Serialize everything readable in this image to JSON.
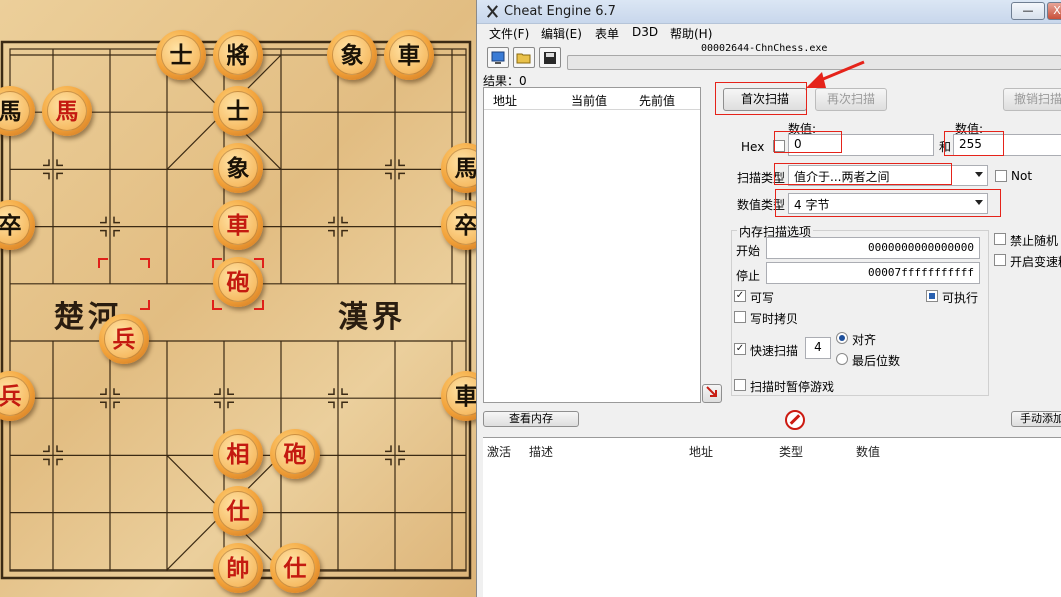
{
  "board": {
    "river_left": "楚河",
    "river_right": "漢界"
  },
  "pieces": [
    {
      "id": "black-shi-1",
      "label": "士",
      "side": "black"
    },
    {
      "id": "black-jiang",
      "label": "將",
      "side": "black"
    },
    {
      "id": "black-xiang-1",
      "label": "象",
      "side": "black"
    },
    {
      "id": "black-ju-1",
      "label": "車",
      "side": "black"
    },
    {
      "id": "red-ma",
      "label": "馬",
      "side": "red"
    },
    {
      "id": "black-ma-1",
      "label": "馬",
      "side": "black"
    },
    {
      "id": "black-shi-2",
      "label": "士",
      "side": "black"
    },
    {
      "id": "black-ma-2",
      "label": "馬",
      "side": "black"
    },
    {
      "id": "black-xiang-2",
      "label": "象",
      "side": "black"
    },
    {
      "id": "black-zu-1",
      "label": "卒",
      "side": "black"
    },
    {
      "id": "red-ju",
      "label": "車",
      "side": "red"
    },
    {
      "id": "black-zu-2",
      "label": "卒",
      "side": "black"
    },
    {
      "id": "red-pao-1",
      "label": "砲",
      "side": "red"
    },
    {
      "id": "red-bing-1",
      "label": "兵",
      "side": "red"
    },
    {
      "id": "red-bing-2",
      "label": "兵",
      "side": "red"
    },
    {
      "id": "black-ju-2",
      "label": "車",
      "side": "black"
    },
    {
      "id": "red-xiang",
      "label": "相",
      "side": "red"
    },
    {
      "id": "red-pao-2",
      "label": "砲",
      "side": "red"
    },
    {
      "id": "red-shi-1",
      "label": "仕",
      "side": "red"
    },
    {
      "id": "red-shuai",
      "label": "帥",
      "side": "red"
    },
    {
      "id": "red-shi-2",
      "label": "仕",
      "side": "red"
    }
  ],
  "window": {
    "title": "Cheat Engine 6.7",
    "minimize": "—",
    "close": "X",
    "menu": [
      "文件(F)",
      "编辑(E)",
      "表单",
      "D3D",
      "帮助(H)"
    ],
    "process": "00002644-ChnChess.exe",
    "results_label": "结果：0",
    "results_columns": [
      "地址",
      "当前值",
      "先前值"
    ],
    "first_scan": "首次扫描",
    "next_scan": "再次扫描",
    "undo_scan": "撤销扫描",
    "hex_label": "Hex",
    "value_label_1": "数值:",
    "value_1": "0",
    "and_label": "和",
    "value_label_2": "数值:",
    "value_2": "255",
    "scan_type_label": "扫描类型",
    "scan_type_value": "值介于...两者之间",
    "not_label": "Not",
    "value_type_label": "数值类型",
    "value_type_value": "4 字节",
    "mem_options_title": "内存扫描选项",
    "start_label": "开始",
    "start_value": "0000000000000000",
    "stop_label": "停止",
    "stop_value": "00007fffffffffff",
    "writable_label": "可写",
    "executable_label": "可执行",
    "copy_on_write_label": "写时拷贝",
    "fast_scan_label": "快速扫描",
    "fast_scan_value": "4",
    "align_label": "对齐",
    "last_digits_label": "最后位数",
    "pause_game_label": "扫描时暂停游戏",
    "disable_random_label": "禁止随机",
    "speedhack_label": "开启变速精",
    "view_memory": "查看内存",
    "manual_add": "手动添加",
    "addr_columns": [
      "激活",
      "描述",
      "地址",
      "类型",
      "数值"
    ],
    "colors": {
      "highlight": "#e5231a",
      "titlebar": "#c8d7ec"
    }
  }
}
